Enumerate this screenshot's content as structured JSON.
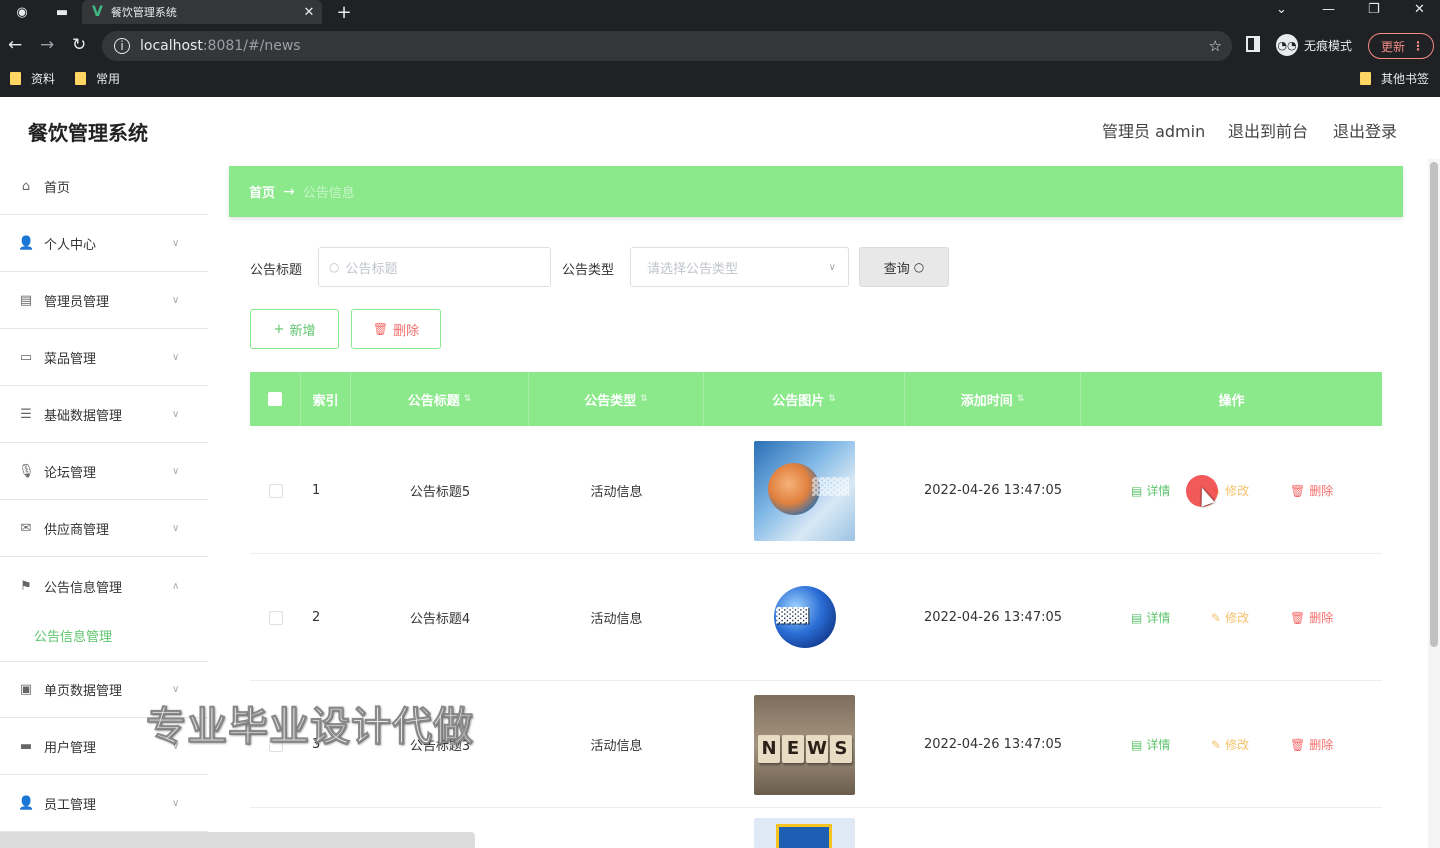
{
  "browser": {
    "tab_title": "餐饮管理系统",
    "url_host": "localhost",
    "url_rest": ":8081/#/news",
    "incognito_label": "无痕模式",
    "update_label": "更新",
    "bookmarks": [
      "资料",
      "常用"
    ],
    "other_bookmarks": "其他书签"
  },
  "app": {
    "title": "餐饮管理系统",
    "user_label": "管理员 admin",
    "to_front": "退出到前台",
    "logout": "退出登录"
  },
  "sidebar": {
    "items": [
      {
        "label": "首页",
        "icon": "home-icon"
      },
      {
        "label": "个人中心",
        "icon": "user-icon"
      },
      {
        "label": "管理员管理",
        "icon": "admin-icon"
      },
      {
        "label": "菜品管理",
        "icon": "dish-icon"
      },
      {
        "label": "基础数据管理",
        "icon": "data-icon"
      },
      {
        "label": "论坛管理",
        "icon": "mic-icon"
      },
      {
        "label": "供应商管理",
        "icon": "mail-icon"
      },
      {
        "label": "公告信息管理",
        "icon": "flag-icon"
      },
      {
        "label": "单页数据管理",
        "icon": "page-icon"
      },
      {
        "label": "用户管理",
        "icon": "monitor-icon"
      },
      {
        "label": "员工管理",
        "icon": "staff-icon"
      }
    ],
    "submenu_active": "公告信息管理"
  },
  "breadcrumb": {
    "home": "首页",
    "arrow": "→",
    "current": "公告信息"
  },
  "search": {
    "title_label": "公告标题",
    "title_placeholder": "公告标题",
    "type_label": "公告类型",
    "type_placeholder": "请选择公告类型",
    "query_label": "查询"
  },
  "actions": {
    "add_label": "新增",
    "delete_label": "删除"
  },
  "table": {
    "headers": [
      "索引",
      "公告标题",
      "公告类型",
      "公告图片",
      "添加时间",
      "操作"
    ],
    "row_actions": {
      "detail": "详情",
      "edit": "修改",
      "delete": "删除"
    },
    "rows": [
      {
        "index": "1",
        "title": "公告标题5",
        "type": "活动信息",
        "image": "news-image-1",
        "time": "2022-04-26 13:47:05"
      },
      {
        "index": "2",
        "title": "公告标题4",
        "type": "活动信息",
        "image": "news-image-2",
        "time": "2022-04-26 13:47:05"
      },
      {
        "index": "3",
        "title": "公告标题3",
        "type": "活动信息",
        "image": "news-image-3",
        "time": "2022-04-26 13:47:05"
      }
    ]
  },
  "watermark": "专业毕业设计代做",
  "colors": {
    "accent": "#8be98b",
    "accent_text": "#5fc46d",
    "danger": "#f56c6c",
    "warning": "#f5c16c"
  }
}
